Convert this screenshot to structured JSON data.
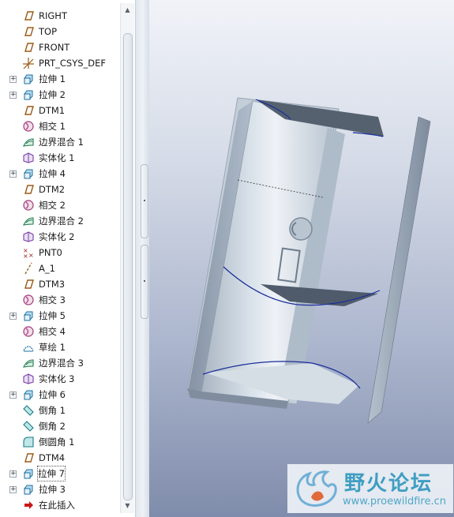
{
  "model_tree": {
    "items": [
      {
        "label": "RIGHT",
        "icon": "datum-plane-icon",
        "expandable": false
      },
      {
        "label": "TOP",
        "icon": "datum-plane-icon",
        "expandable": false
      },
      {
        "label": "FRONT",
        "icon": "datum-plane-icon",
        "expandable": false
      },
      {
        "label": "PRT_CSYS_DEF",
        "icon": "coordinate-system-icon",
        "expandable": false
      },
      {
        "label": "拉伸 1",
        "icon": "extrude-icon",
        "expandable": true
      },
      {
        "label": "拉伸 2",
        "icon": "extrude-icon",
        "expandable": true
      },
      {
        "label": "DTM1",
        "icon": "datum-plane-icon",
        "expandable": false
      },
      {
        "label": "相交 1",
        "icon": "intersect-icon",
        "expandable": false
      },
      {
        "label": "边界混合 1",
        "icon": "boundary-blend-icon",
        "expandable": false
      },
      {
        "label": "实体化 1",
        "icon": "solidify-icon",
        "expandable": false
      },
      {
        "label": "拉伸 4",
        "icon": "extrude-icon",
        "expandable": true
      },
      {
        "label": "DTM2",
        "icon": "datum-plane-icon",
        "expandable": false
      },
      {
        "label": "相交 2",
        "icon": "intersect-icon",
        "expandable": false
      },
      {
        "label": "边界混合 2",
        "icon": "boundary-blend-icon",
        "expandable": false
      },
      {
        "label": "实体化 2",
        "icon": "solidify-icon",
        "expandable": false
      },
      {
        "label": "PNT0",
        "icon": "datum-point-icon",
        "expandable": false
      },
      {
        "label": "A_1",
        "icon": "datum-axis-icon",
        "expandable": false
      },
      {
        "label": "DTM3",
        "icon": "datum-plane-icon",
        "expandable": false
      },
      {
        "label": "相交 3",
        "icon": "intersect-icon",
        "expandable": false
      },
      {
        "label": "拉伸 5",
        "icon": "extrude-icon",
        "expandable": true
      },
      {
        "label": "相交 4",
        "icon": "intersect-icon",
        "expandable": false
      },
      {
        "label": "草绘 1",
        "icon": "sketch-icon",
        "expandable": false
      },
      {
        "label": "边界混合 3",
        "icon": "boundary-blend-icon",
        "expandable": false
      },
      {
        "label": "实体化 3",
        "icon": "solidify-icon",
        "expandable": false
      },
      {
        "label": "拉伸 6",
        "icon": "extrude-icon",
        "expandable": true
      },
      {
        "label": "倒角 1",
        "icon": "chamfer-icon",
        "expandable": false
      },
      {
        "label": "倒角 2",
        "icon": "chamfer-icon",
        "expandable": false
      },
      {
        "label": "倒圆角 1",
        "icon": "round-icon",
        "expandable": false
      },
      {
        "label": "DTM4",
        "icon": "datum-plane-icon",
        "expandable": false
      },
      {
        "label": "拉伸 7",
        "icon": "extrude-icon",
        "expandable": true,
        "selected": true
      },
      {
        "label": "拉伸 3",
        "icon": "extrude-icon",
        "expandable": true
      },
      {
        "label": "在此插入",
        "icon": "insert-here-arrow-icon",
        "expandable": false
      }
    ]
  },
  "watermark": {
    "title": "野火论坛",
    "url": "www.proewildfire.cn"
  },
  "colors": {
    "viewport_top": "#f1f3f8",
    "viewport_bottom": "#7f8cab",
    "model_face": "#c5d0da",
    "model_edge": "#1a2d9c",
    "watermark_text": "#3f9ec2"
  }
}
